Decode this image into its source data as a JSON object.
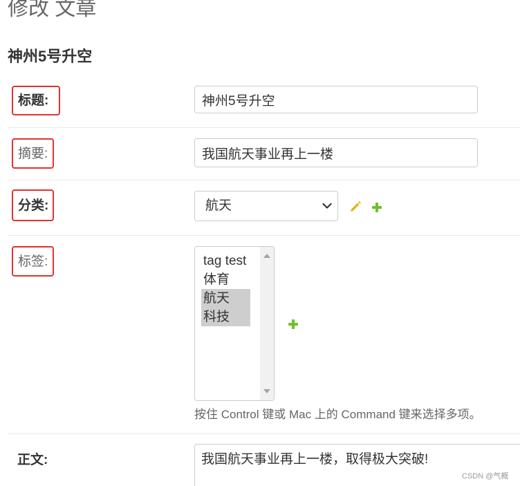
{
  "page": {
    "title": "修改 文章",
    "object_title": "神州5号升空"
  },
  "form": {
    "title": {
      "label": "标题:",
      "value": "神州5号升空"
    },
    "summary": {
      "label": "摘要:",
      "value": "我国航天事业再上一楼"
    },
    "category": {
      "label": "分类:",
      "selected": "航天"
    },
    "tags": {
      "label": "标签:",
      "options": [
        {
          "text": "tag test",
          "selected": false
        },
        {
          "text": "体育",
          "selected": false
        },
        {
          "text": "航天",
          "selected": true
        },
        {
          "text": "科技",
          "selected": true
        }
      ],
      "help": "按住 Control 键或 Mac 上的 Command 键来选择多项。"
    },
    "body": {
      "label": "正文:",
      "value": "我国航天事业再上一楼，取得极大突破!"
    }
  },
  "watermark": "CSDN @气概",
  "icons": {
    "category_edit": "pencil-icon",
    "category_add": "plus-icon",
    "tags_add": "plus-icon",
    "select_dropdown": "chevron-down-icon"
  },
  "colors": {
    "label_highlight": "#e0322f",
    "add_icon": "#70bf2b",
    "edit_icon": "#e6b31c",
    "selected_option_bg": "#cecece"
  }
}
